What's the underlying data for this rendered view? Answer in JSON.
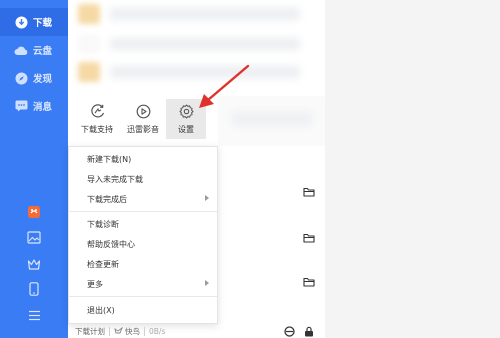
{
  "sidebar": {
    "nav": [
      {
        "label": "下载",
        "icon": "download-icon"
      },
      {
        "label": "云盘",
        "icon": "cloud-icon"
      },
      {
        "label": "发现",
        "icon": "compass-icon"
      },
      {
        "label": "消息",
        "icon": "message-icon"
      }
    ],
    "bottom_icons": [
      "gift-icon",
      "image-icon",
      "crown-icon",
      "phone-icon",
      "menu-icon"
    ]
  },
  "toolbar": {
    "items": [
      {
        "label": "下载支持",
        "icon": "download-support-icon"
      },
      {
        "label": "迅雷影音",
        "icon": "player-icon"
      },
      {
        "label": "设置",
        "icon": "gear-icon"
      }
    ]
  },
  "menu": {
    "items": [
      {
        "label": "新建下载(N)"
      },
      {
        "label": "导入未完成下载"
      },
      {
        "label": "下载完成后"
      },
      {
        "label": "下载诊断"
      },
      {
        "label": "帮助反馈中心"
      },
      {
        "label": "检查更新"
      },
      {
        "label": "更多"
      },
      {
        "label": "退出(X)"
      }
    ]
  },
  "statusbar": {
    "plan": "下载计划",
    "speed_mode": "快鸟",
    "speed": "0B/s"
  },
  "colors": {
    "sidebar": "#3a7cf3",
    "arrow": "#e0322c"
  }
}
